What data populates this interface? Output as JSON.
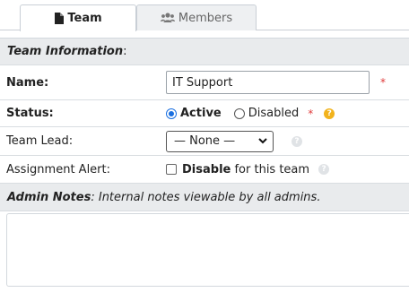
{
  "tabs": [
    {
      "label": "Team",
      "icon": "file-icon",
      "active": true
    },
    {
      "label": "Members",
      "icon": "users-icon",
      "active": false
    }
  ],
  "section_header": {
    "title": "Team Information",
    "suffix": ":"
  },
  "fields": {
    "name": {
      "label": "Name:",
      "value": "IT Support",
      "required_mark": "*"
    },
    "status": {
      "label": "Status:",
      "option_active": "Active",
      "option_disabled": "Disabled",
      "selected": "Active",
      "required_mark": "*",
      "help": "?"
    },
    "team_lead": {
      "label": "Team Lead:",
      "selected": "— None —",
      "help": "?"
    },
    "assignment_alert": {
      "label": "Assignment Alert:",
      "checkbox_bold": "Disable",
      "checkbox_rest": " for this team",
      "checked": false,
      "help": "?"
    }
  },
  "admin_notes": {
    "title": "Admin Notes",
    "description": ": Internal notes viewable by all admins.",
    "value": ""
  },
  "colors": {
    "accent": "#1a6fe0",
    "required": "#e03c3c",
    "help_orange": "#f2b31d",
    "header_bg": "#e9ebed"
  }
}
